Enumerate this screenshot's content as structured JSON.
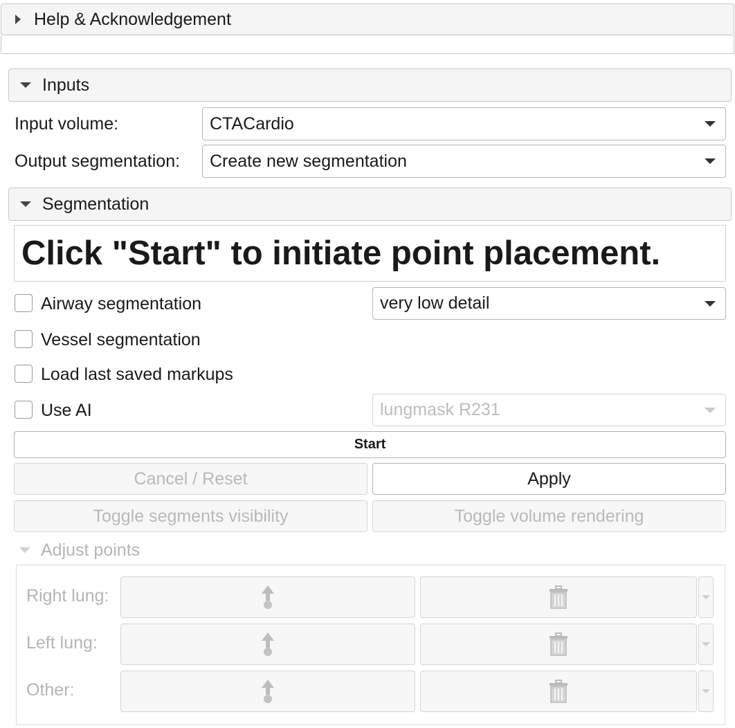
{
  "sections": {
    "help": "Help & Acknowledgement",
    "inputs": "Inputs",
    "segmentation": "Segmentation",
    "adjust_points": "Adjust points"
  },
  "inputs": {
    "input_volume_label": "Input volume:",
    "input_volume_value": "CTACardio",
    "output_seg_label": "Output segmentation:",
    "output_seg_value": "Create new segmentation"
  },
  "segmentation": {
    "instruction": "Click \"Start\" to initiate point placement.",
    "airway_label": "Airway segmentation",
    "airway_detail": "very low detail",
    "vessel_label": "Vessel segmentation",
    "load_markups_label": "Load last saved markups",
    "use_ai_label": "Use AI",
    "ai_model": "lungmask R231",
    "start": "Start",
    "cancel_reset": "Cancel / Reset",
    "apply": "Apply",
    "toggle_segments": "Toggle segments visibility",
    "toggle_volume": "Toggle volume rendering"
  },
  "adjust_points": {
    "rows": [
      {
        "label": "Right lung:"
      },
      {
        "label": "Left lung:"
      },
      {
        "label": "Other:"
      }
    ]
  },
  "icons": {
    "place": "place-point-icon",
    "delete": "trash-icon",
    "expand": "chevron-down-icon"
  },
  "colors": {
    "header_bg": "#f5f5f5",
    "border": "#c7c7c7",
    "disabled_text": "#b5b5b5"
  }
}
